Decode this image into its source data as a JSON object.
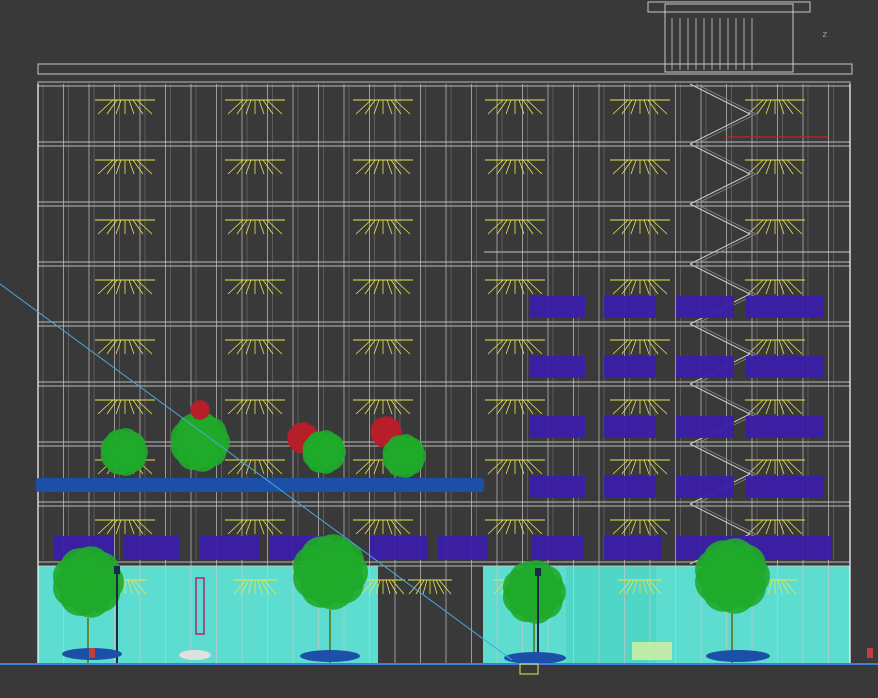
{
  "viewport": {
    "view": "Front elevation",
    "axis_label": "z",
    "colors": {
      "background": "#393939",
      "structure": "#c8c8c8",
      "light_fixture": "#e8e84a",
      "glass": "#5ee6d8",
      "planter": "#1c4fa8",
      "shrub": "#3b1ea8",
      "tree": "#1faa2a",
      "tree_red": "#b81e2a",
      "guide_line": "#4aa8d8"
    }
  }
}
